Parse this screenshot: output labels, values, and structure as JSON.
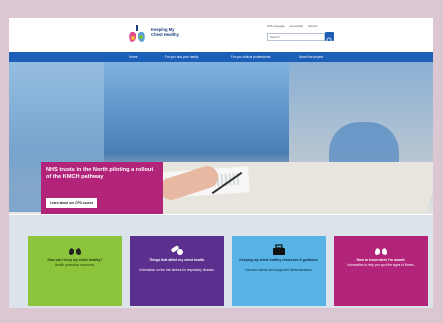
{
  "header": {
    "logo_line1": "Keeping My",
    "logo_line2": "Chest Healthy",
    "top_links": [
      "NHS Language",
      "Accessibility",
      "Member"
    ],
    "search_placeholder": "Search"
  },
  "nav": {
    "items": [
      "Home",
      "For you and your family",
      "For you clinical professional",
      "About the project"
    ]
  },
  "hero": {
    "title": "NHS trusts in the North piloting a rollout of the KMCH pathway",
    "button": "Learn about our CPD course",
    "slides": 3,
    "active_slide": 2
  },
  "cards": [
    {
      "title": "How can I keep my chest healthy?",
      "desc": "Health promotion resources.",
      "icon": "lungs-icon",
      "color": "#8cc43c"
    },
    {
      "title": "Things that affect my chest health.",
      "desc": "Information on the risk factors for respiratory disease.",
      "icon": "pills-icon",
      "color": "#5b2f8d"
    },
    {
      "title": "Keeping my chest healthy resources & guidance.",
      "desc": "Includes videos and equipment demonstrations.",
      "icon": "toolbox-icon",
      "color": "#58b4e6"
    },
    {
      "title": "How to know when I'm unwell.",
      "desc": "Information to help you spot the signs of illness.",
      "icon": "lungs-alert-icon",
      "color": "#b2237a"
    }
  ]
}
